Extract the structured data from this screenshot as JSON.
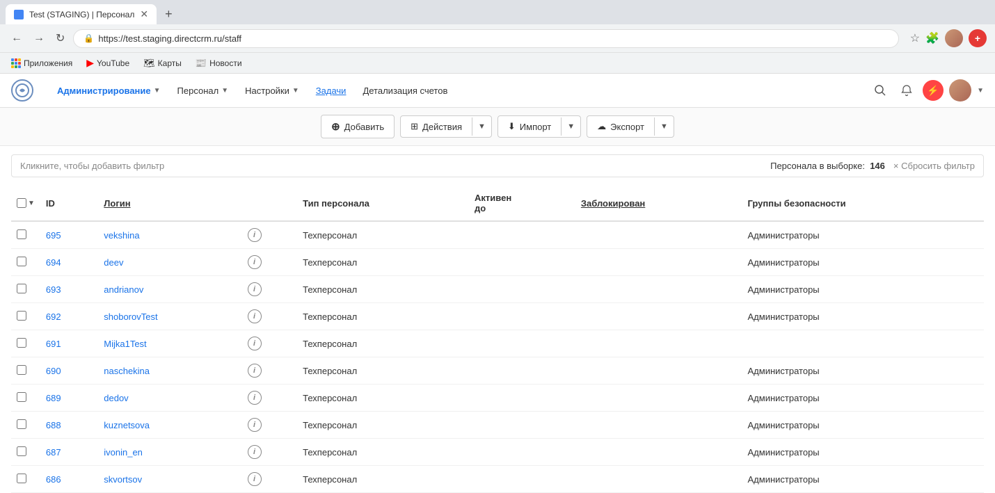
{
  "browser": {
    "tab_title": "Test (STAGING) | Персонал",
    "url": "https://test.staging.directcrm.ru/staff",
    "bookmarks": [
      {
        "label": "Приложения",
        "type": "apps"
      },
      {
        "label": "YouTube",
        "type": "youtube"
      },
      {
        "label": "Карты",
        "type": "maps"
      },
      {
        "label": "Новости",
        "type": "news"
      }
    ]
  },
  "header": {
    "logo_initials": "DC",
    "nav_items": [
      {
        "label": "Администрирование",
        "dropdown": true,
        "active": true
      },
      {
        "label": "Персонал",
        "dropdown": true
      },
      {
        "label": "Настройки",
        "dropdown": true
      },
      {
        "label": "Задачи",
        "link": true
      },
      {
        "label": "Детализация счетов",
        "link": true
      }
    ]
  },
  "toolbar": {
    "add_label": "Добавить",
    "actions_label": "Действия",
    "import_label": "Импорт",
    "export_label": "Экспорт"
  },
  "filter": {
    "placeholder": "Кликните, чтобы добавить фильтр",
    "count_label": "Персонала в выборке:",
    "count_value": "146",
    "reset_label": "× Сбросить фильтр"
  },
  "table": {
    "columns": [
      {
        "key": "checkbox",
        "label": ""
      },
      {
        "key": "id",
        "label": "ID"
      },
      {
        "key": "login",
        "label": "Логин"
      },
      {
        "key": "info",
        "label": ""
      },
      {
        "key": "staff_type",
        "label": "Тип персонала"
      },
      {
        "key": "active_until",
        "label": "Активен до"
      },
      {
        "key": "blocked",
        "label": "Заблокирован",
        "sortable": true
      },
      {
        "key": "security_groups",
        "label": "Группы безопасности"
      }
    ],
    "rows": [
      {
        "id": "695",
        "login": "vekshina",
        "staff_type": "Техперсонал",
        "active_until": "",
        "blocked": "",
        "security_groups": "Администраторы"
      },
      {
        "id": "694",
        "login": "deev",
        "staff_type": "Техперсонал",
        "active_until": "",
        "blocked": "",
        "security_groups": "Администраторы"
      },
      {
        "id": "693",
        "login": "andrianov",
        "staff_type": "Техперсонал",
        "active_until": "",
        "blocked": "",
        "security_groups": "Администраторы"
      },
      {
        "id": "692",
        "login": "shoborovTest",
        "staff_type": "Техперсонал",
        "active_until": "",
        "blocked": "",
        "security_groups": "Администраторы"
      },
      {
        "id": "691",
        "login": "Mijka1Test",
        "staff_type": "Техперсонал",
        "active_until": "",
        "blocked": "",
        "security_groups": ""
      },
      {
        "id": "690",
        "login": "naschekina",
        "staff_type": "Техперсонал",
        "active_until": "",
        "blocked": "",
        "security_groups": "Администраторы"
      },
      {
        "id": "689",
        "login": "dedov",
        "staff_type": "Техперсонал",
        "active_until": "",
        "blocked": "",
        "security_groups": "Администраторы"
      },
      {
        "id": "688",
        "login": "kuznetsova",
        "staff_type": "Техперсонал",
        "active_until": "",
        "blocked": "",
        "security_groups": "Администраторы"
      },
      {
        "id": "687",
        "login": "ivonin_en",
        "staff_type": "Техперсонал",
        "active_until": "",
        "blocked": "",
        "security_groups": "Администраторы"
      },
      {
        "id": "686",
        "login": "skvortsov",
        "staff_type": "Техперсонал",
        "active_until": "",
        "blocked": "",
        "security_groups": "Администраторы"
      }
    ]
  }
}
